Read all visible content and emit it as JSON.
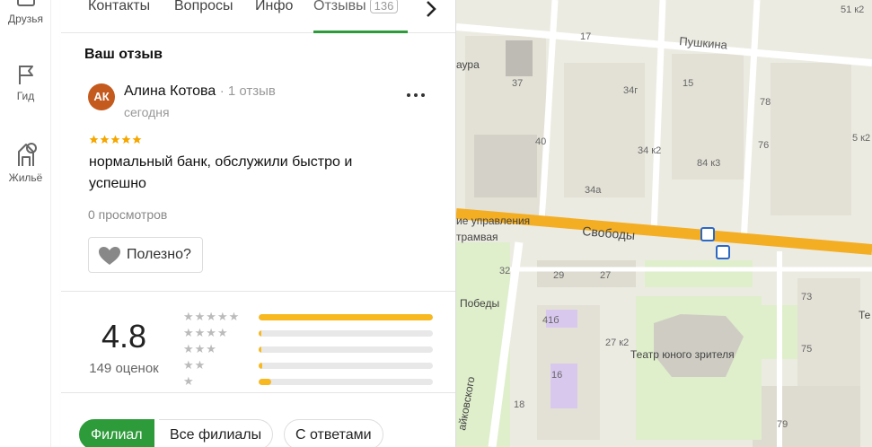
{
  "rail": {
    "friends": "Друзья",
    "guide": "Гид",
    "housing": "Жильё"
  },
  "tabs": {
    "contacts": "Контакты",
    "questions": "Вопросы",
    "info": "Инфо",
    "reviews": "Отзывы",
    "reviews_count": "136"
  },
  "review": {
    "section_title": "Ваш отзыв",
    "avatar_initials": "АК",
    "author": "Алина Котова",
    "author_meta": "· 1 отзыв",
    "date": "сегодня",
    "stars": 5,
    "text": "нормальный банк, обслужили быстро и успешно",
    "views": "0 просмотров",
    "useful_label": "Полезно?"
  },
  "rating": {
    "value": "4.8",
    "count_text": "149 оценок",
    "distribution": [
      {
        "stars": 5,
        "fraction": 1.0
      },
      {
        "stars": 4,
        "fraction": 0.01
      },
      {
        "stars": 3,
        "fraction": 0.01
      },
      {
        "stars": 2,
        "fraction": 0.02
      },
      {
        "stars": 1,
        "fraction": 0.07
      }
    ]
  },
  "filters": {
    "branch": "Филиал",
    "all_branches": "Все филиалы",
    "with_answers": "С ответами"
  },
  "map": {
    "street_pushkina": "Пушкина",
    "street_svobody": "Свободы",
    "label_upravleniya": "ие управления",
    "label_tramvaya": "трамвая",
    "label_pobedy": "Победы",
    "label_theatre": "Театр юного зрителя",
    "label_chaikovskogo": "айковского",
    "label_aura": "аура",
    "label_te": "Те",
    "numbers": [
      "17",
      "37",
      "34г",
      "15",
      "40",
      "34 к2",
      "84 к3",
      "34а",
      "78",
      "76",
      "32",
      "29",
      "27",
      "41б",
      "27 к2",
      "16",
      "18",
      "73",
      "75",
      "79",
      "51 к2",
      "5 к2"
    ]
  }
}
